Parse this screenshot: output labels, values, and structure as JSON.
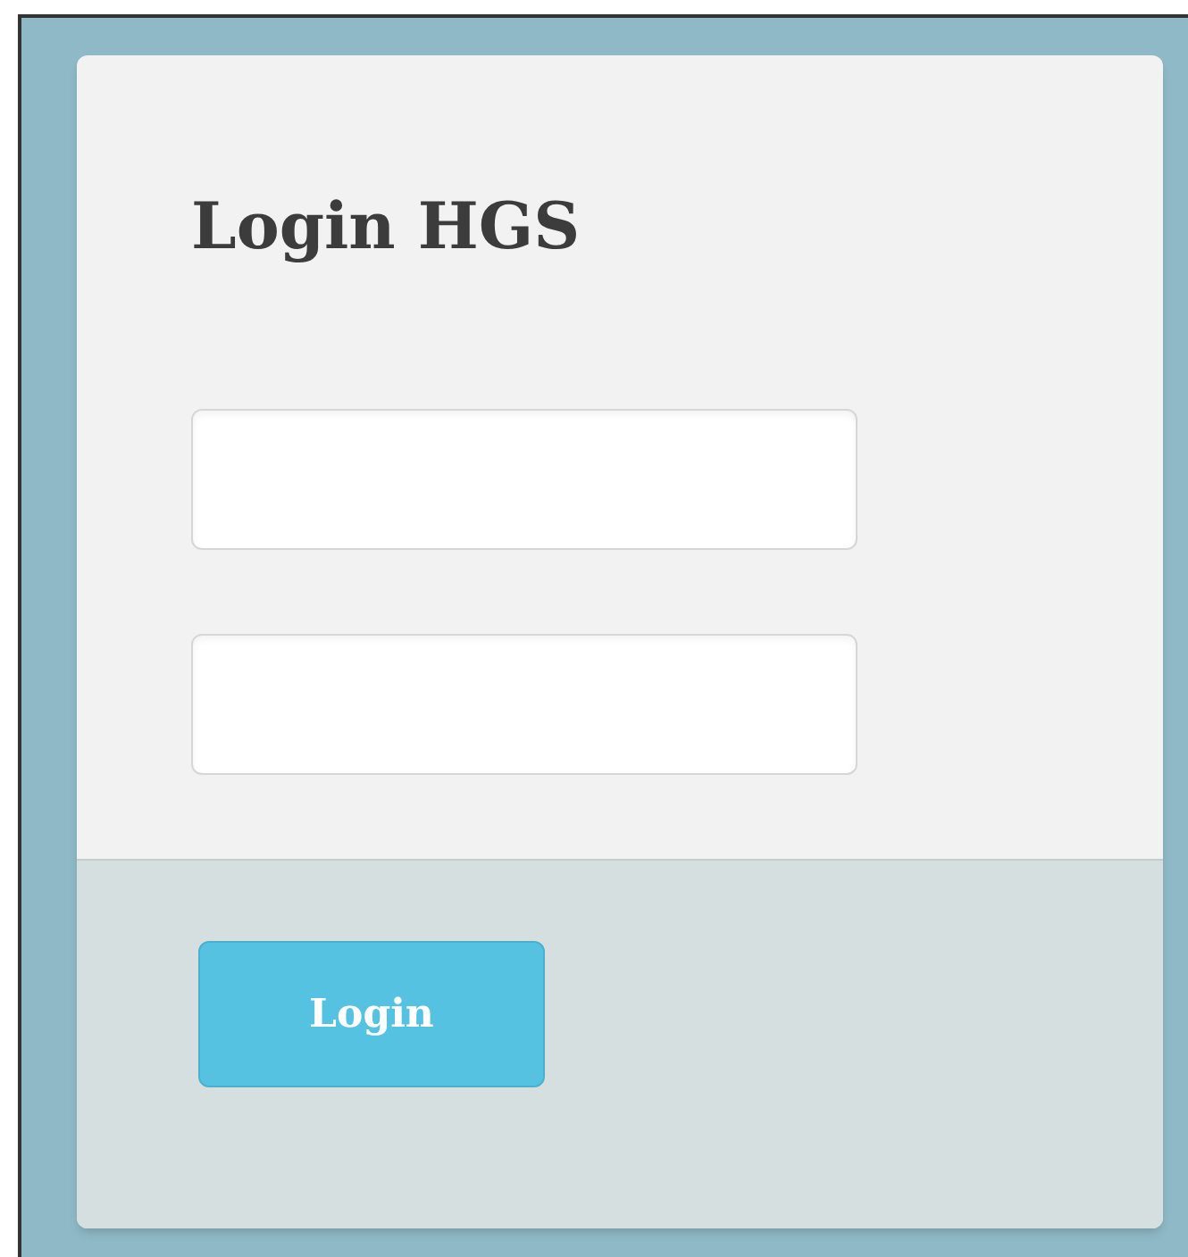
{
  "form": {
    "title": "Login HGS",
    "fields": [
      {
        "kind": "input"
      },
      {
        "kind": "input"
      }
    ],
    "submit": "Login"
  }
}
